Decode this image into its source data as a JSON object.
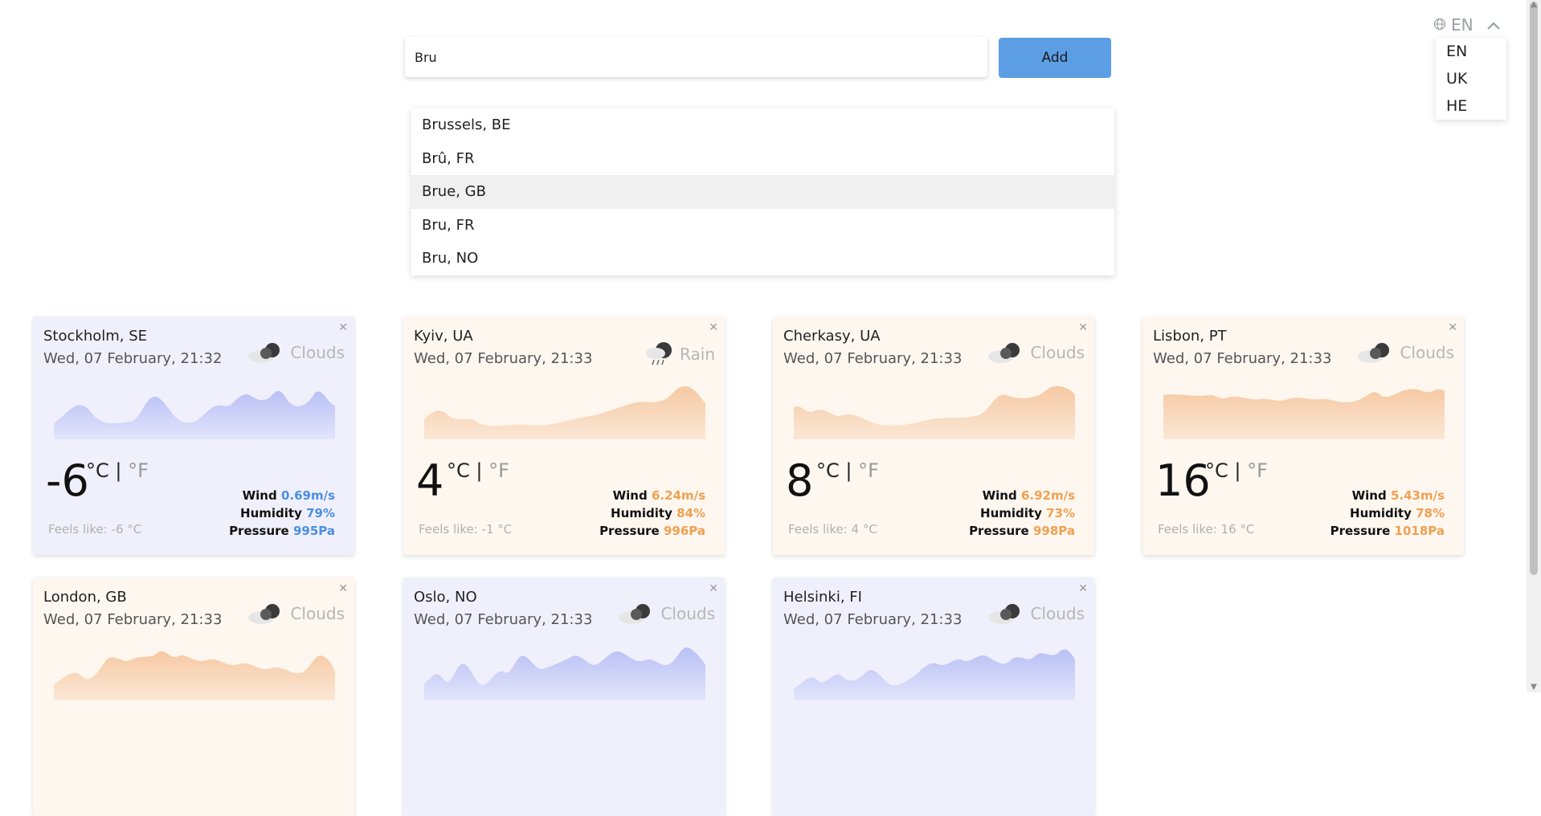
{
  "search": {
    "value": "Bru",
    "placeholder": "",
    "add_label": "Add"
  },
  "suggestions": [
    "Brussels, BE",
    "Brû, FR",
    "Brue, GB",
    "Bru, FR",
    "Bru, NO"
  ],
  "language": {
    "current": "EN",
    "options": [
      "EN",
      "UK",
      "HE"
    ]
  },
  "colors": {
    "cold_bg": "#f0f0fc",
    "warm_bg": "#fdf7ef",
    "cold_accent": "#4a8fe0",
    "warm_accent": "#f0a052",
    "button": "#5b9ee4"
  },
  "cards": [
    {
      "city": "Stockholm, SE",
      "date": "Wed, 07 February, 21:32",
      "condition": "Clouds",
      "icon": "clouds-icon",
      "temp": "-6",
      "unit_c": "°C",
      "sep": "|",
      "unit_f": "°F",
      "feels": "Feels like: -6 °C",
      "wind_label": "Wind",
      "wind": "0.69m/s",
      "humidity_label": "Humidity",
      "humidity": "79%",
      "pressure_label": "Pressure",
      "pressure": "995Pa",
      "theme": "cold"
    },
    {
      "city": "Kyiv, UA",
      "date": "Wed, 07 February, 21:33",
      "condition": "Rain",
      "icon": "rain-icon",
      "temp": "4",
      "unit_c": "°C",
      "sep": "|",
      "unit_f": "°F",
      "feels": "Feels like: -1 °C",
      "wind_label": "Wind",
      "wind": "6.24m/s",
      "humidity_label": "Humidity",
      "humidity": "84%",
      "pressure_label": "Pressure",
      "pressure": "996Pa",
      "theme": "warm"
    },
    {
      "city": "Cherkasy, UA",
      "date": "Wed, 07 February, 21:33",
      "condition": "Clouds",
      "icon": "clouds-icon",
      "temp": "8",
      "unit_c": "°C",
      "sep": "|",
      "unit_f": "°F",
      "feels": "Feels like: 4 °C",
      "wind_label": "Wind",
      "wind": "6.92m/s",
      "humidity_label": "Humidity",
      "humidity": "73%",
      "pressure_label": "Pressure",
      "pressure": "998Pa",
      "theme": "warm"
    },
    {
      "city": "Lisbon, PT",
      "date": "Wed, 07 February, 21:33",
      "condition": "Clouds",
      "icon": "clouds-icon",
      "temp": "16",
      "unit_c": "°C",
      "sep": "|",
      "unit_f": "°F",
      "feels": "Feels like: 16 °C",
      "wind_label": "Wind",
      "wind": "5.43m/s",
      "humidity_label": "Humidity",
      "humidity": "78%",
      "pressure_label": "Pressure",
      "pressure": "1018Pa",
      "theme": "warm"
    },
    {
      "city": "London, GB",
      "date": "Wed, 07 February, 21:33",
      "condition": "Clouds",
      "icon": "clouds-icon",
      "theme": "warm"
    },
    {
      "city": "Oslo, NO",
      "date": "Wed, 07 February, 21:33",
      "condition": "Clouds",
      "icon": "clouds-icon",
      "theme": "cold"
    },
    {
      "city": "Helsinki, FI",
      "date": "Wed, 07 February, 21:33",
      "condition": "Clouds",
      "icon": "clouds-icon",
      "theme": "cold"
    }
  ]
}
